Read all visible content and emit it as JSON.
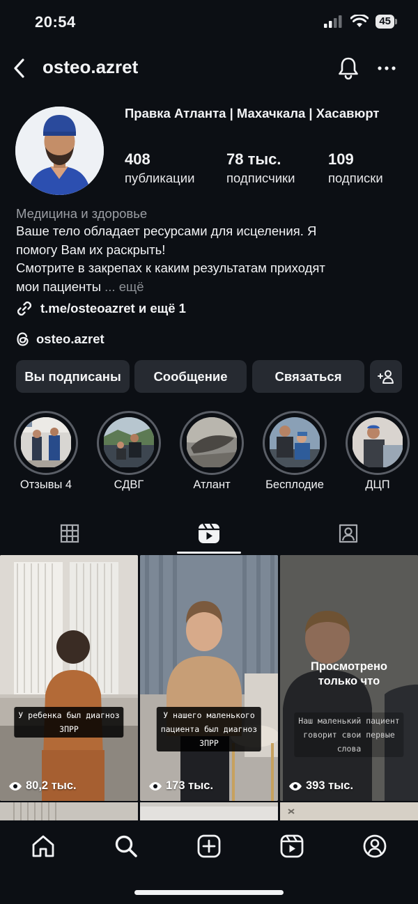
{
  "status_bar": {
    "time": "20:54",
    "battery": "45"
  },
  "header": {
    "username": "osteo.azret"
  },
  "profile": {
    "display_name": "Правка Атланта | Махачкала | Хасавюрт",
    "stats": [
      {
        "value": "408",
        "label": "публикации"
      },
      {
        "value": "78 тыс.",
        "label": "подписчики"
      },
      {
        "value": "109",
        "label": "подписки"
      }
    ],
    "category": "Медицина и здоровье",
    "bio_lines": [
      "Ваше тело обладает ресурсами для исцеления. Я",
      "помогу Вам их раскрыть!",
      "Смотрите в закрепах к каким результатам приходят",
      "мои пациенты"
    ],
    "bio_more": "... ещё",
    "link": "t.me/osteoazret и ещё 1",
    "threads": "osteo.azret"
  },
  "actions": {
    "following": "Вы подписаны",
    "message": "Сообщение",
    "contact": "Связаться"
  },
  "highlights": [
    {
      "label": "Отзывы 4"
    },
    {
      "label": "СДВГ"
    },
    {
      "label": "Атлант"
    },
    {
      "label": "Бесплодие"
    },
    {
      "label": "ДЦП"
    }
  ],
  "reels": [
    {
      "caption_lines": [
        "У ребенка был диагноз",
        "ЗПРР"
      ],
      "views": "80,2 тыс."
    },
    {
      "caption_lines": [
        "У нашего маленького",
        "пациента был диагноз",
        "ЗПРР"
      ],
      "views": "173 тыс."
    },
    {
      "seen_lines": [
        "Просмотрено",
        "только что"
      ],
      "caption_lines": [
        "Наш маленький пациент",
        "говорит свои первые",
        "слова"
      ],
      "views": "393 тыс."
    }
  ],
  "icons": {
    "back": "chevron-left-icon",
    "bell": "bell-icon",
    "more": "more-horizontal-icon",
    "link": "link-icon",
    "threads": "threads-icon",
    "add_person": "add-person-icon",
    "grid": "grid-icon",
    "reels": "reels-icon",
    "tagged": "tagged-icon",
    "home": "home-icon",
    "search": "search-icon",
    "create": "create-icon",
    "profile": "profile-icon"
  }
}
